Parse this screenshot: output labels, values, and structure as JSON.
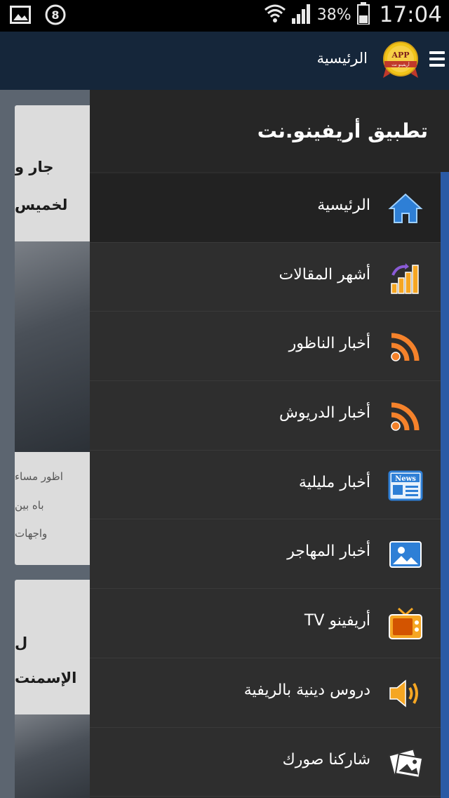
{
  "status_bar": {
    "battery_percent": "38%",
    "time": "17:04",
    "notification_badge": "8",
    "icons": [
      "image-icon",
      "notification-badge-icon",
      "wifi-icon",
      "signal-icon",
      "battery-icon"
    ]
  },
  "app_bar": {
    "title": "الرئيسية",
    "logo_text": "APP",
    "logo_subtext": "أريفينو نت"
  },
  "background_cards": [
    {
      "title_line1": "جار و",
      "title_line2": "لخميس",
      "text_lines": [
        "اظور مساء",
        "باه بين",
        "واجهات"
      ]
    },
    {
      "title_line1": "ل",
      "title_line2": "الإسمنت"
    }
  ],
  "drawer": {
    "title": "تطبيق أريفينو.نت",
    "items": [
      {
        "label": "الرئيسية",
        "icon": "home-icon",
        "active": true
      },
      {
        "label": "أشهر المقالات",
        "icon": "popular-chart-icon",
        "active": false
      },
      {
        "label": "أخبار الناظور",
        "icon": "rss-icon",
        "active": false
      },
      {
        "label": "أخبار الدريوش",
        "icon": "rss-icon",
        "active": false
      },
      {
        "label": "أخبار مليلية",
        "icon": "news-icon",
        "active": false
      },
      {
        "label": "أخبار المهاجر",
        "icon": "photo-icon",
        "active": false
      },
      {
        "label": "أريفينو TV",
        "icon": "tv-icon",
        "active": false
      },
      {
        "label": "دروس دينية بالريفية",
        "icon": "speaker-icon",
        "active": false
      },
      {
        "label": "شاركنا صورك",
        "icon": "share-photos-icon",
        "active": false
      }
    ],
    "news_icon_text": "News"
  },
  "colors": {
    "appbar": "#15263a",
    "drawer": "#2d2d2d",
    "accent_blue": "#2a5aa5",
    "icon_orange": "#f5a623",
    "icon_blue": "#2e7fd6"
  }
}
